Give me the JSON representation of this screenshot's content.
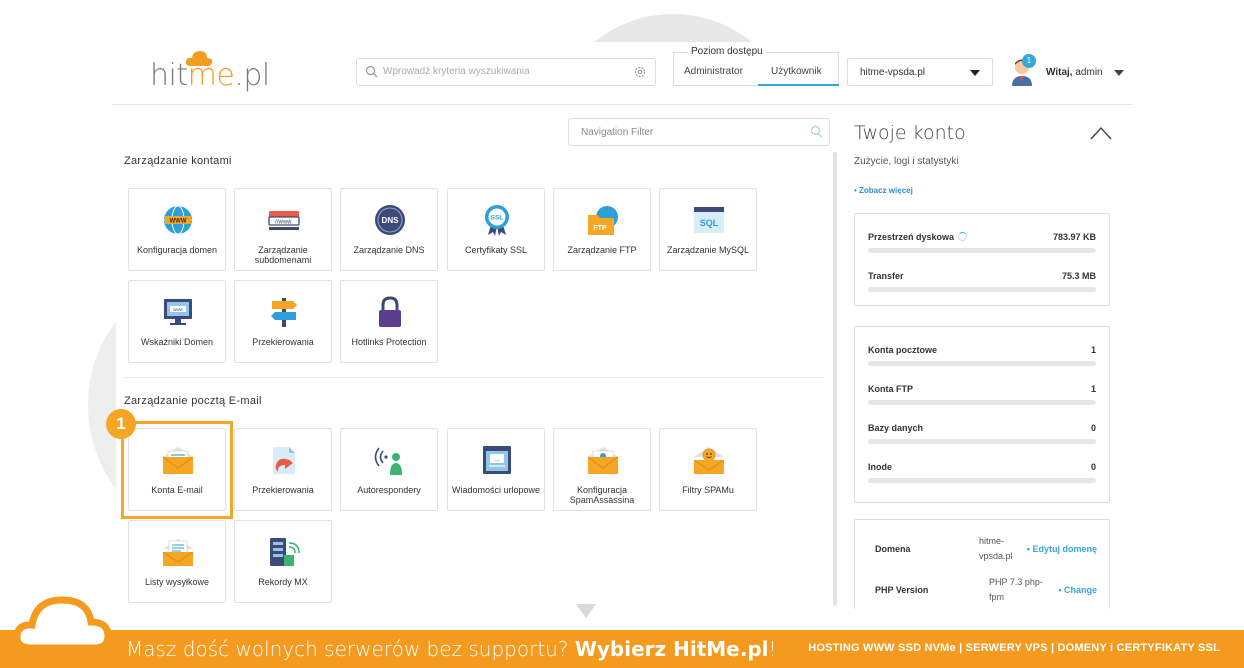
{
  "header": {
    "logo": {
      "text_a": "hit",
      "text_b": "me",
      "text_c": ".pl"
    },
    "search": {
      "placeholder": "Wprowadź kryteria wyszukiwania"
    },
    "access": {
      "title": "Poziom dostępu",
      "options": [
        "Administrator",
        "Użytkownik"
      ],
      "selected": "Użytkownik"
    },
    "domain_select": {
      "value": "hitme-vpsda.pl"
    },
    "user": {
      "badge": "1",
      "greeting": "Witaj,",
      "name": "admin"
    }
  },
  "nav_filter": {
    "placeholder": "Navigation Filter"
  },
  "sections": {
    "accounts": {
      "title": "Zarządzanie kontami",
      "tiles": [
        {
          "label": "Konfiguracja domen",
          "icon": "globe-www-icon"
        },
        {
          "label": "Zarządzanie subdomenami",
          "icon": "subdomain-icon"
        },
        {
          "label": "Zarządzanie DNS",
          "icon": "dns-icon"
        },
        {
          "label": "Certyfikaty SSL",
          "icon": "ssl-certificate-icon"
        },
        {
          "label": "Zarządzanie FTP",
          "icon": "ftp-folder-icon"
        },
        {
          "label": "Zarządzanie MySQL",
          "icon": "sql-database-icon"
        },
        {
          "label": "Wskaźniki Domen",
          "icon": "monitor-www-icon"
        },
        {
          "label": "Przekierowania",
          "icon": "signpost-icon"
        },
        {
          "label": "Hotlinks Protection",
          "icon": "padlock-icon"
        }
      ]
    },
    "email": {
      "title": "Zarządzanie pocztą E-mail",
      "tiles": [
        {
          "label": "Konta E-mail",
          "icon": "email-envelope-icon"
        },
        {
          "label": "Przekierowania",
          "icon": "email-forward-icon"
        },
        {
          "label": "Autorespondery",
          "icon": "autoresponder-icon"
        },
        {
          "label": "Wiadomości urlopowe",
          "icon": "vacation-message-icon"
        },
        {
          "label": "Konfiguracja SpamAssassina",
          "icon": "spamassassin-icon"
        },
        {
          "label": "Filtry SPAMu",
          "icon": "spam-filter-icon"
        },
        {
          "label": "Listy wysyłkowe",
          "icon": "mailing-list-icon"
        },
        {
          "label": "Rekordy MX",
          "icon": "mx-records-icon"
        }
      ]
    }
  },
  "step_badge": "1",
  "account": {
    "title": "Twoje konto",
    "subtitle": "Zużycie, logi i statystyki",
    "more_link": "• Zobacz więcej",
    "usage": [
      {
        "name": "Przestrzeń dyskowa",
        "value": "783.97 KB"
      },
      {
        "name": "Transfer",
        "value": "75.3 MB"
      }
    ],
    "counts": [
      {
        "name": "Konta pocztowe",
        "value": "1"
      },
      {
        "name": "Konta FTP",
        "value": "1"
      },
      {
        "name": "Bazy danych",
        "value": "0"
      },
      {
        "name": "Inode",
        "value": "0"
      }
    ],
    "info": [
      {
        "key": "Domena",
        "value": "hitme-vpsda.pl",
        "link": "• Edytuj domenę"
      },
      {
        "key": "PHP Version",
        "value": "PHP 7.3 php-fpm",
        "link": "• Change"
      }
    ]
  },
  "banner": {
    "message_plain": "Masz dość wolnych serwerów bez supportu? ",
    "message_bold": "Wybierz HitMe.pl",
    "message_end": "!",
    "right": "HOSTING WWW SSD NVMe | SERWERY VPS | DOMENY i CERTYFIKATY SSL"
  },
  "colors": {
    "accent": "#f5a623",
    "banner": "#f49a1f",
    "link": "#3aa6d8"
  }
}
